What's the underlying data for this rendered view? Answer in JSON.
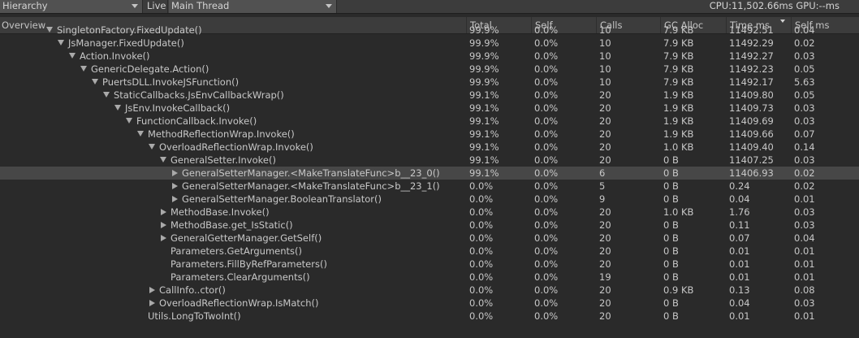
{
  "toolbar": {
    "view_label": "Hierarchy",
    "live_label": "Live",
    "thread_label": "Main Thread",
    "cpu_gpu": "CPU:11,502.66ms   GPU:--ms"
  },
  "columns": [
    "Overview",
    "Total",
    "Self",
    "Calls",
    "GC Alloc",
    "Time ms",
    "Self ms"
  ],
  "rows": [
    {
      "name": "SingletonFactory.FixedUpdate()",
      "depth": 0,
      "expander": "down",
      "total": "99.9%",
      "self": "0.0%",
      "calls": "10",
      "gc": "7.9 KB",
      "time": "11492.51",
      "selfms": "0.04",
      "selected": false
    },
    {
      "name": "JsManager.FixedUpdate()",
      "depth": 1,
      "expander": "down",
      "total": "99.9%",
      "self": "0.0%",
      "calls": "10",
      "gc": "7.9 KB",
      "time": "11492.29",
      "selfms": "0.02",
      "selected": false
    },
    {
      "name": "Action.Invoke()",
      "depth": 2,
      "expander": "down",
      "total": "99.9%",
      "self": "0.0%",
      "calls": "10",
      "gc": "7.9 KB",
      "time": "11492.27",
      "selfms": "0.03",
      "selected": false
    },
    {
      "name": "GenericDelegate.Action()",
      "depth": 3,
      "expander": "down",
      "total": "99.9%",
      "self": "0.0%",
      "calls": "10",
      "gc": "7.9 KB",
      "time": "11492.23",
      "selfms": "0.05",
      "selected": false
    },
    {
      "name": "PuertsDLL.InvokeJSFunction()",
      "depth": 4,
      "expander": "down",
      "total": "99.9%",
      "self": "0.0%",
      "calls": "10",
      "gc": "7.9 KB",
      "time": "11492.17",
      "selfms": "5.63",
      "selected": false
    },
    {
      "name": "StaticCallbacks.JsEnvCallbackWrap()",
      "depth": 5,
      "expander": "down",
      "total": "99.1%",
      "self": "0.0%",
      "calls": "20",
      "gc": "1.9 KB",
      "time": "11409.80",
      "selfms": "0.05",
      "selected": false
    },
    {
      "name": "JsEnv.InvokeCallback()",
      "depth": 6,
      "expander": "down",
      "total": "99.1%",
      "self": "0.0%",
      "calls": "20",
      "gc": "1.9 KB",
      "time": "11409.73",
      "selfms": "0.03",
      "selected": false
    },
    {
      "name": "FunctionCallback.Invoke()",
      "depth": 7,
      "expander": "down",
      "total": "99.1%",
      "self": "0.0%",
      "calls": "20",
      "gc": "1.9 KB",
      "time": "11409.69",
      "selfms": "0.03",
      "selected": false
    },
    {
      "name": "MethodReflectionWrap.Invoke()",
      "depth": 8,
      "expander": "down",
      "total": "99.1%",
      "self": "0.0%",
      "calls": "20",
      "gc": "1.9 KB",
      "time": "11409.66",
      "selfms": "0.07",
      "selected": false
    },
    {
      "name": "OverloadReflectionWrap.Invoke()",
      "depth": 9,
      "expander": "down",
      "total": "99.1%",
      "self": "0.0%",
      "calls": "20",
      "gc": "1.0 KB",
      "time": "11409.40",
      "selfms": "0.14",
      "selected": false
    },
    {
      "name": "GeneralSetter.Invoke()",
      "depth": 10,
      "expander": "down",
      "total": "99.1%",
      "self": "0.0%",
      "calls": "20",
      "gc": "0 B",
      "time": "11407.25",
      "selfms": "0.03",
      "selected": false
    },
    {
      "name": "GeneralSetterManager.<MakeTranslateFunc>b__23_0()",
      "depth": 11,
      "expander": "right",
      "total": "99.1%",
      "self": "0.0%",
      "calls": "6",
      "gc": "0 B",
      "time": "11406.93",
      "selfms": "0.02",
      "selected": true
    },
    {
      "name": "GeneralSetterManager.<MakeTranslateFunc>b__23_1()",
      "depth": 11,
      "expander": "right",
      "total": "0.0%",
      "self": "0.0%",
      "calls": "5",
      "gc": "0 B",
      "time": "0.24",
      "selfms": "0.02",
      "selected": false
    },
    {
      "name": "GeneralSetterManager.BooleanTranslator()",
      "depth": 11,
      "expander": "right",
      "total": "0.0%",
      "self": "0.0%",
      "calls": "9",
      "gc": "0 B",
      "time": "0.04",
      "selfms": "0.01",
      "selected": false
    },
    {
      "name": "MethodBase.Invoke()",
      "depth": 10,
      "expander": "right",
      "total": "0.0%",
      "self": "0.0%",
      "calls": "20",
      "gc": "1.0 KB",
      "time": "1.76",
      "selfms": "0.03",
      "selected": false
    },
    {
      "name": "MethodBase.get_IsStatic()",
      "depth": 10,
      "expander": "right",
      "total": "0.0%",
      "self": "0.0%",
      "calls": "20",
      "gc": "0 B",
      "time": "0.11",
      "selfms": "0.03",
      "selected": false
    },
    {
      "name": "GeneralGetterManager.GetSelf()",
      "depth": 10,
      "expander": "right",
      "total": "0.0%",
      "self": "0.0%",
      "calls": "20",
      "gc": "0 B",
      "time": "0.07",
      "selfms": "0.04",
      "selected": false
    },
    {
      "name": "Parameters.GetArguments()",
      "depth": 10,
      "expander": "none",
      "total": "0.0%",
      "self": "0.0%",
      "calls": "20",
      "gc": "0 B",
      "time": "0.01",
      "selfms": "0.01",
      "selected": false
    },
    {
      "name": "Parameters.FillByRefParameters()",
      "depth": 10,
      "expander": "none",
      "total": "0.0%",
      "self": "0.0%",
      "calls": "20",
      "gc": "0 B",
      "time": "0.01",
      "selfms": "0.01",
      "selected": false
    },
    {
      "name": "Parameters.ClearArguments()",
      "depth": 10,
      "expander": "none",
      "total": "0.0%",
      "self": "0.0%",
      "calls": "19",
      "gc": "0 B",
      "time": "0.01",
      "selfms": "0.01",
      "selected": false
    },
    {
      "name": "CallInfo..ctor()",
      "depth": 9,
      "expander": "right",
      "total": "0.0%",
      "self": "0.0%",
      "calls": "20",
      "gc": "0.9 KB",
      "time": "0.13",
      "selfms": "0.08",
      "selected": false
    },
    {
      "name": "OverloadReflectionWrap.IsMatch()",
      "depth": 9,
      "expander": "right",
      "total": "0.0%",
      "self": "0.0%",
      "calls": "20",
      "gc": "0 B",
      "time": "0.04",
      "selfms": "0.03",
      "selected": false
    },
    {
      "name": "Utils.LongToTwoInt()",
      "depth": 8,
      "expander": "none",
      "total": "0.0%",
      "self": "0.0%",
      "calls": "20",
      "gc": "0 B",
      "time": "0.01",
      "selfms": "0.01",
      "selected": false
    }
  ]
}
